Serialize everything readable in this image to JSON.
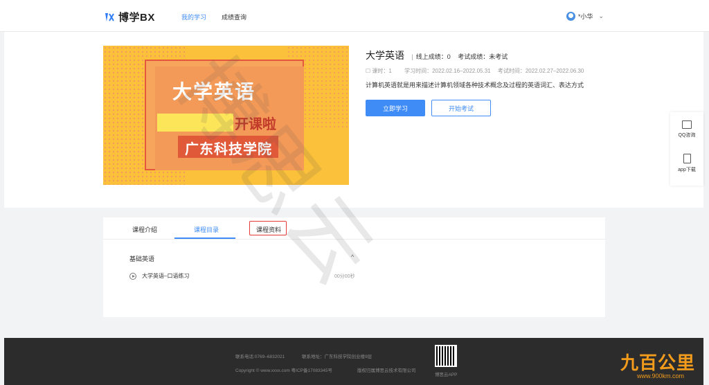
{
  "nav": {
    "logo_text": "博学BX",
    "items": [
      {
        "label": "我的学习",
        "active": true
      },
      {
        "label": "成绩查询",
        "active": false
      }
    ],
    "user_name": "*小华",
    "user_chevron": "⌄"
  },
  "course": {
    "cover_title": "大学英语",
    "cover_subtitle": "开课啦",
    "cover_school": "广东科技学院",
    "title": "大学英语",
    "online_score": "线上成绩：0",
    "exam_score": "考试成绩：未考试",
    "lessons": "课时：1",
    "study_time": "学习时间：2022.02.16–2022.05.31",
    "exam_time": "考试时间：2022.02.27–2022.06.30",
    "description": "计算机英语就是用来描述计算机领域各种技术概念及过程的英语词汇、表达方式",
    "start_study_label": "立即学习",
    "start_exam_label": "开始考试"
  },
  "float_panel": {
    "items": [
      {
        "label": "QQ咨询",
        "icon": "chat-icon"
      },
      {
        "label": "app下载",
        "icon": "tablet-icon"
      }
    ]
  },
  "tabs": {
    "items": [
      {
        "label": "课程介绍",
        "active": false
      },
      {
        "label": "课程目录",
        "active": true
      },
      {
        "label": "课程资料",
        "active": false,
        "highlighted": true
      }
    ]
  },
  "catalog": {
    "section_title": "基础英语",
    "section_caret": "^",
    "lesson_title": "大学英语–口语练习",
    "lesson_duration": "00分00秒"
  },
  "footer": {
    "phone": "联系电话:0769–6832021",
    "address": "联系地址：广东科技学院创业楼9层",
    "copyright": "Copyright © www.xxxx.com 粤ICP备17083345号",
    "rights": "版权归属博思云技术有限公司",
    "app_label": "博思云APP"
  },
  "watermark": "博思云",
  "badge": {
    "text": "九百公里",
    "url": "www.900km.com"
  },
  "colors": {
    "accent": "#3f8cf7",
    "highlight_border": "#e53935",
    "footer_bg": "#2c2c2c",
    "badge": "#f39c1c"
  }
}
